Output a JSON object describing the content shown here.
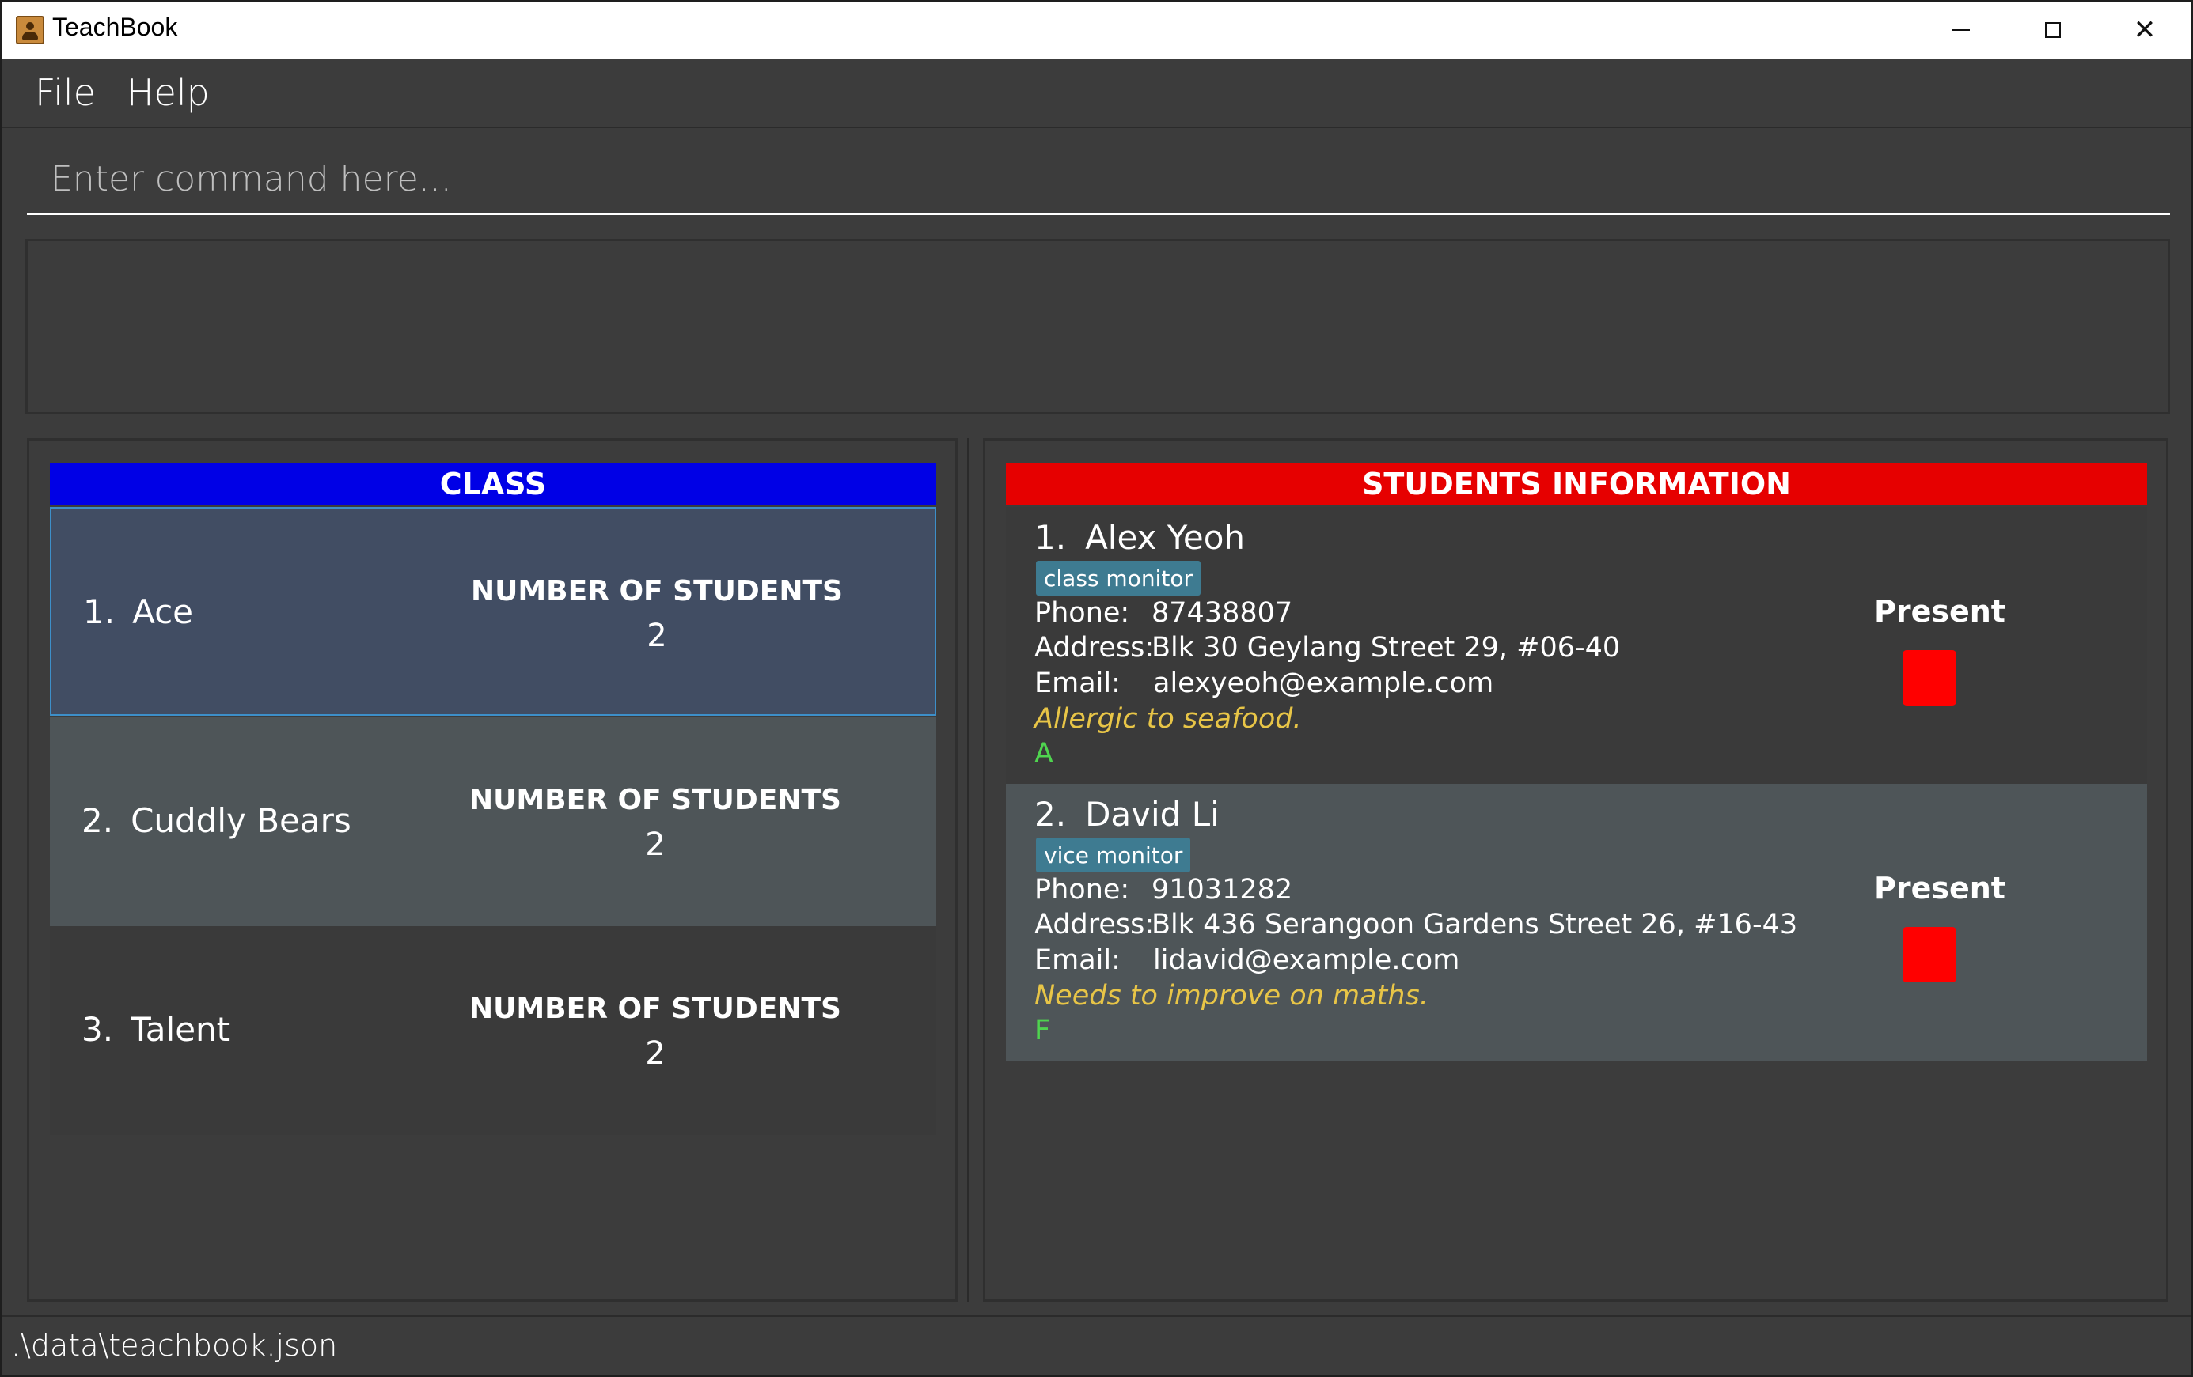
{
  "window": {
    "title": "TeachBook",
    "minimize_icon": "minimize-icon",
    "maximize_icon": "maximize-icon",
    "close_icon": "close-icon",
    "close_glyph": "✕"
  },
  "menu": {
    "file": "File",
    "help": "Help"
  },
  "command": {
    "placeholder": "Enter command here...",
    "value": ""
  },
  "result": {
    "text": ""
  },
  "classes": {
    "header": "CLASS",
    "header_color": "#0000e6",
    "items": [
      {
        "index": "1.",
        "name": "Ace",
        "count_label": "NUMBER OF STUDENTS",
        "count": "2",
        "selected": true
      },
      {
        "index": "2.",
        "name": "Cuddly Bears",
        "count_label": "NUMBER OF STUDENTS",
        "count": "2",
        "selected": false
      },
      {
        "index": "3.",
        "name": "Talent",
        "count_label": "NUMBER OF STUDENTS",
        "count": "2",
        "selected": false
      }
    ]
  },
  "students": {
    "header": "STUDENTS INFORMATION",
    "header_color": "#e60000",
    "items": [
      {
        "index": "1.",
        "name": "Alex Yeoh",
        "tag": "class monitor",
        "phone_label": "Phone:",
        "phone": "87438807",
        "address_label": "Address:",
        "address": "Blk 30 Geylang Street 29, #06-40",
        "email_label": "Email:",
        "email": "alexyeoh@example.com",
        "remark": "Allergic to seafood.",
        "grade": "A",
        "attendance_label": "Present",
        "attendance_color": "#ff0000"
      },
      {
        "index": "2.",
        "name": "David Li",
        "tag": "vice monitor",
        "phone_label": "Phone:",
        "phone": "91031282",
        "address_label": "Address:",
        "address": "Blk 436 Serangoon Gardens Street 26, #16-43",
        "email_label": "Email:",
        "email": "lidavid@example.com",
        "remark": "Needs to improve on maths.",
        "grade": "F",
        "attendance_label": "Present",
        "attendance_color": "#ff0000"
      }
    ]
  },
  "status": {
    "file_path": ".\\data\\teachbook.json"
  }
}
